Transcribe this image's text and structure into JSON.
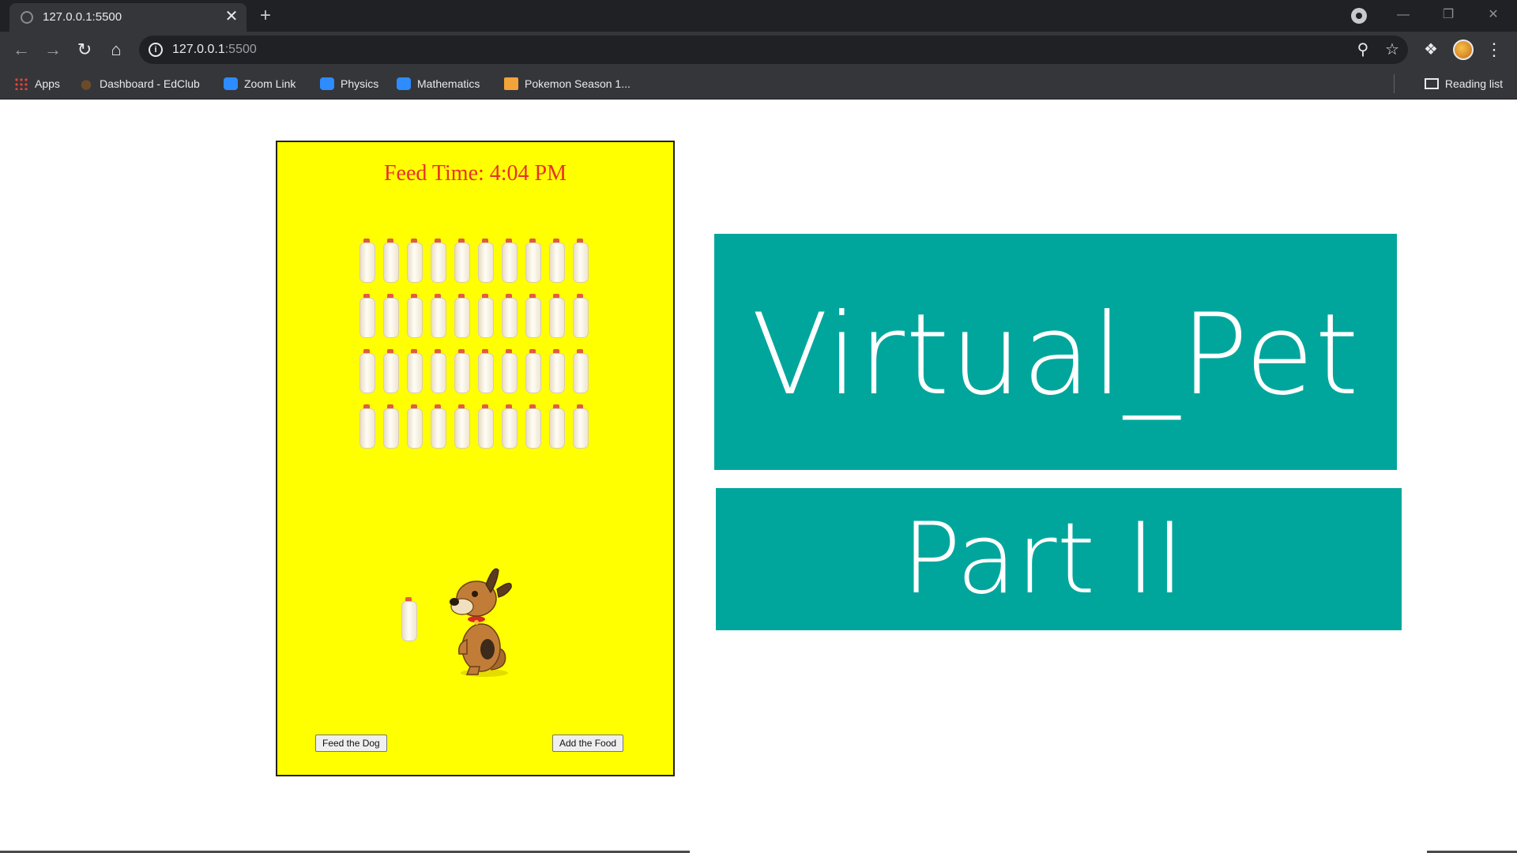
{
  "browser": {
    "tab_title": "127.0.0.1:5500",
    "tab_close": "✕",
    "new_tab": "+",
    "window_controls": {
      "minimize": "—",
      "restore": "❐",
      "close": "✕"
    },
    "address": {
      "host": "127.0.0.1",
      "port": ":5500"
    },
    "bookmarks": [
      {
        "label": "Apps",
        "icon": "apps-grid-icon"
      },
      {
        "label": "Dashboard - EdClub",
        "icon": "edclub-icon"
      },
      {
        "label": "Zoom Link",
        "icon": "zoom-icon"
      },
      {
        "label": "Physics",
        "icon": "zoom-icon"
      },
      {
        "label": "Mathematics",
        "icon": "zoom-icon"
      },
      {
        "label": "Pokemon Season 1...",
        "icon": "pokemon-icon"
      }
    ],
    "reading_list": "Reading list"
  },
  "game": {
    "feed_time": "Feed Time: 4:04 PM",
    "milk_bottle_count": 40,
    "feed_button": "Feed the Dog",
    "add_button": "Add the Food"
  },
  "overlay": {
    "title": "Virtual_Pet",
    "subtitle": "Part II"
  },
  "colors": {
    "canvas_bg": "#ffff00",
    "feed_time_text": "#e8312b",
    "banner_bg": "#00a69c",
    "banner_text": "#ffffff"
  }
}
